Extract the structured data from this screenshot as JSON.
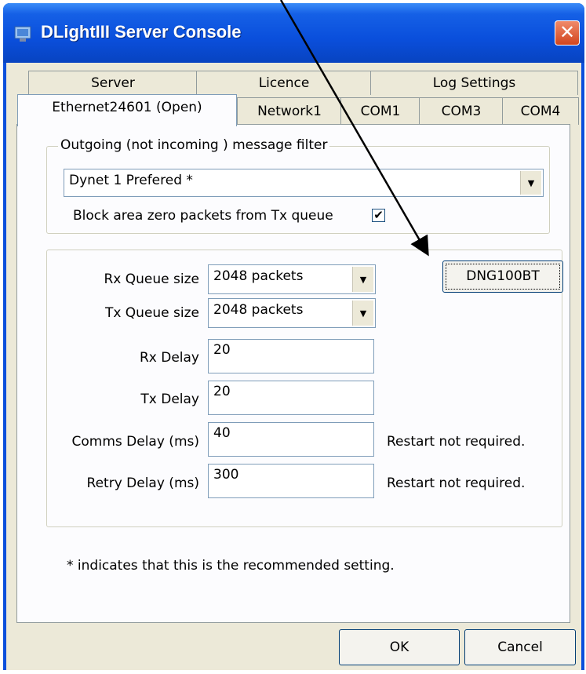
{
  "window": {
    "title": "DLightIII Server Console"
  },
  "tabs_row1": [
    "Server",
    "Licence",
    "Log Settings"
  ],
  "tabs_row2": [
    "Ethernet24601 (Open)",
    "Network1",
    "COM1",
    "COM3",
    "COM4"
  ],
  "filter_group": {
    "legend": "Outgoing (not incoming ) message filter",
    "selected": "Dynet 1 Prefered *",
    "block_label": "Block area zero packets from Tx queue",
    "block_checked": true
  },
  "settings": {
    "rx_queue_label": "Rx Queue size",
    "rx_queue_value": "2048 packets",
    "tx_queue_label": "Tx Queue size",
    "tx_queue_value": "2048 packets",
    "rx_delay_label": "Rx Delay",
    "rx_delay_value": "20",
    "tx_delay_label": "Tx Delay",
    "tx_delay_value": "20",
    "comms_delay_label": "Comms Delay (ms)",
    "comms_delay_value": "40",
    "comms_delay_note": "Restart not required.",
    "retry_delay_label": "Retry Delay (ms)",
    "retry_delay_value": "300",
    "retry_delay_note": "Restart not required.",
    "device_button": "DNG100BT"
  },
  "footnote": "* indicates that this is the recommended setting.",
  "buttons": {
    "ok": "OK",
    "cancel": "Cancel"
  },
  "colors": {
    "titlebar": "#0a4fdc",
    "dialog_bg": "#ece9d8",
    "panel_bg": "#fcfcfe",
    "close": "#d2451e"
  },
  "icons": {
    "app": "server-console-icon",
    "close": "close-icon",
    "dropdown": "chevron-down-icon",
    "check": "checkmark-icon"
  }
}
